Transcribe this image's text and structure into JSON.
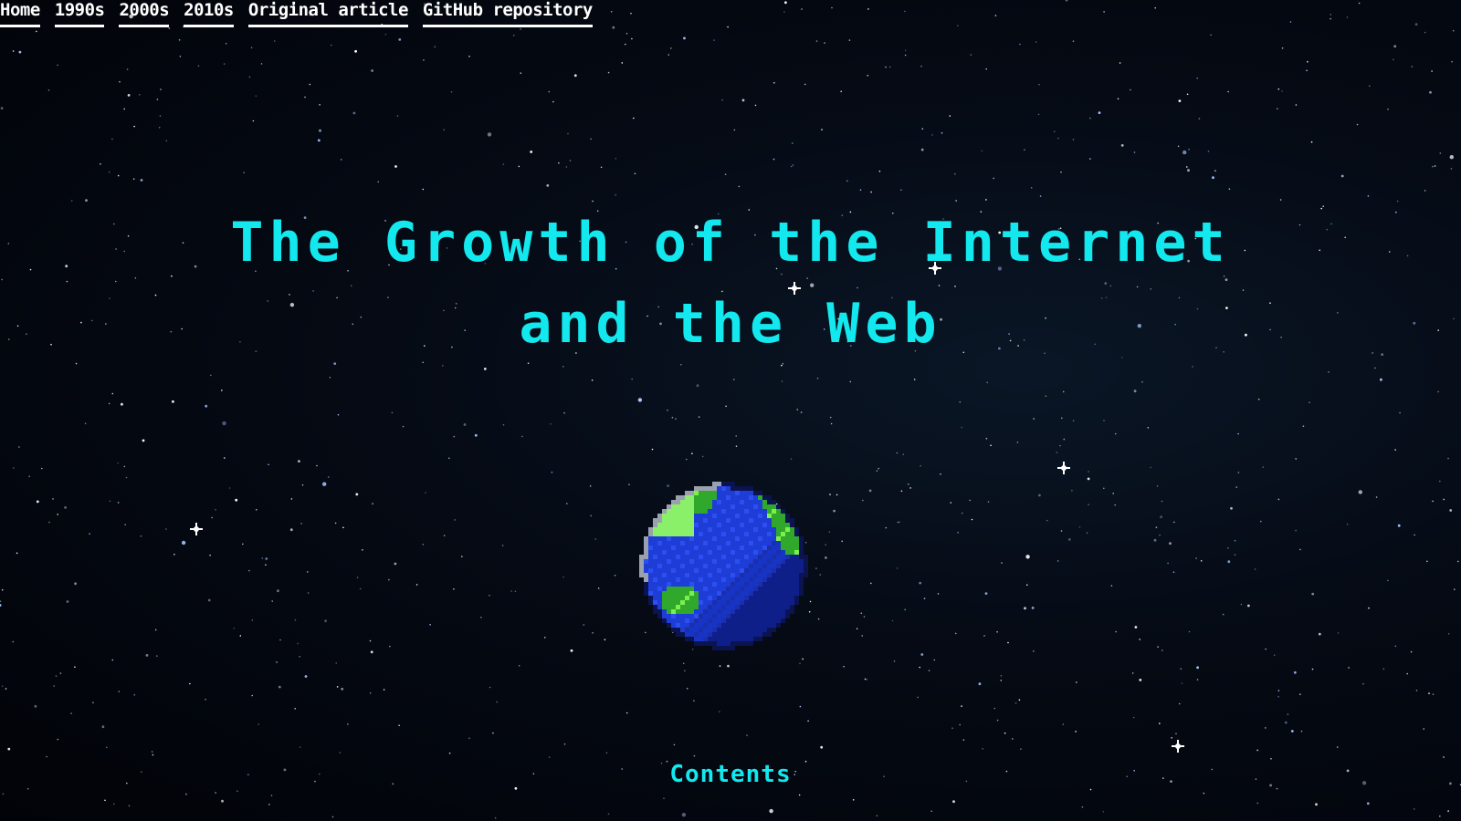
{
  "nav": {
    "links": [
      "Home",
      "1990s",
      "2000s",
      "2010s",
      "Original article",
      "GitHub repository"
    ]
  },
  "hero": {
    "title_line1": "The Growth of the Internet",
    "title_line2": "and the Web"
  },
  "contents_label": "Contents",
  "colors": {
    "title": "#12e8ee",
    "nav_text": "#ffffff",
    "background": "#02050c",
    "ocean": "#1e3cd6",
    "land": "#2fa82c"
  },
  "icons": {
    "globe": "pixel-earth-globe"
  }
}
